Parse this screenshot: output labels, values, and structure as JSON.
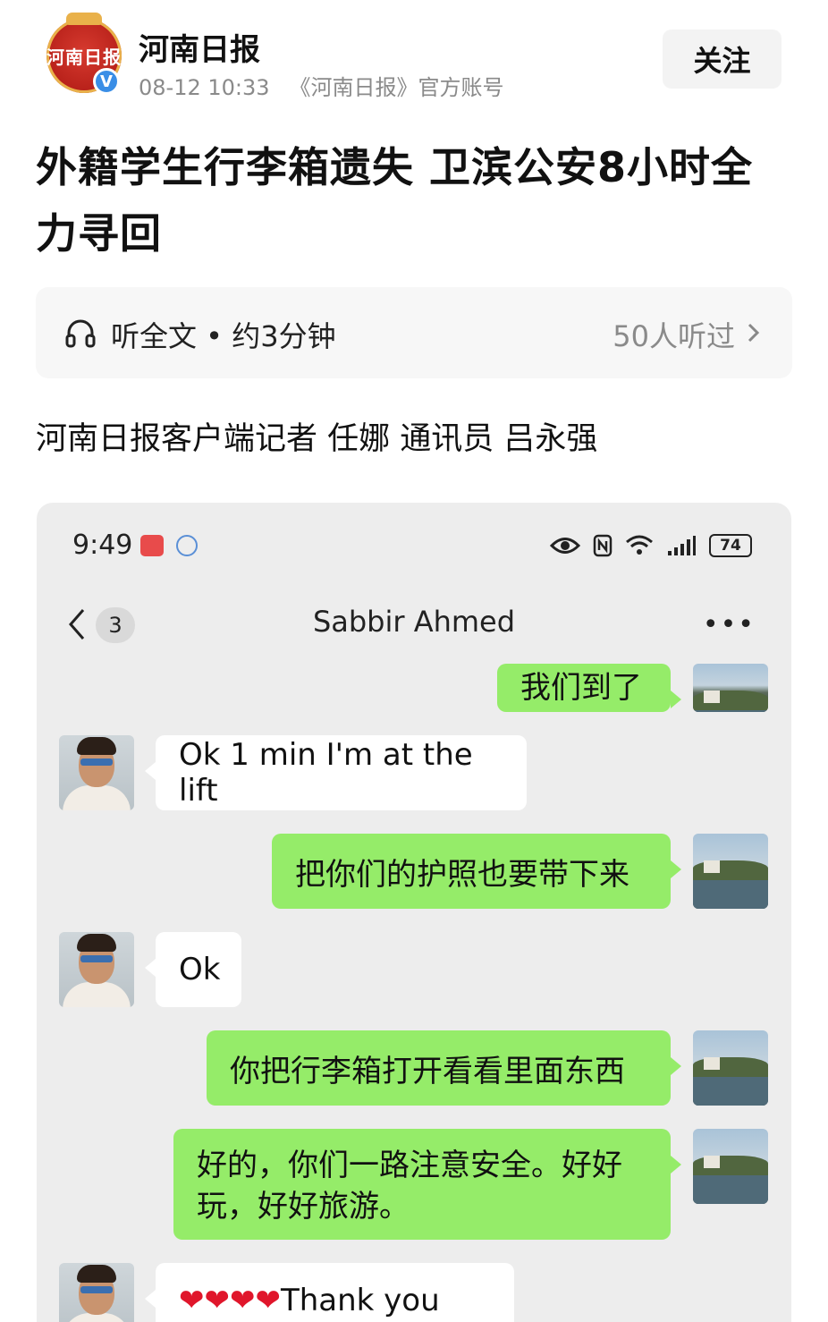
{
  "header": {
    "logo_text": "河南日报",
    "verified_mark": "V",
    "account_name": "河南日报",
    "time": "08-12 10:33",
    "account_desc": "《河南日报》官方账号",
    "follow_label": "关注"
  },
  "article": {
    "title": "外籍学生行李箱遗失 卫滨公安8小时全力寻回",
    "audio_label": "听全文 • 约3分钟",
    "audio_count": "50人听过",
    "byline": "河南日报客户端记者 任娜 通讯员 吕永强"
  },
  "chat_screenshot": {
    "status_time": "9:49",
    "battery": "74",
    "unread_count": "3",
    "contact_name": "Sabbir Ahmed",
    "more_label": "•••",
    "messages": [
      {
        "from": "me",
        "text": "我们到了"
      },
      {
        "from": "them",
        "text": "Ok 1 min I'm at the lift"
      },
      {
        "from": "me",
        "text": "把你们的护照也要带下来"
      },
      {
        "from": "them",
        "text": "Ok"
      },
      {
        "from": "me",
        "text": "你把行李箱打开看看里面东西"
      },
      {
        "from": "me",
        "text": "好的，你们一路注意安全。好好玩，好好旅游。"
      },
      {
        "from": "them",
        "hearts": "❤❤❤❤",
        "text": "Thank you"
      }
    ]
  },
  "icons": {
    "headphones": "headphones-icon",
    "chevron": "chevron-right-icon",
    "back": "back-arrow-icon"
  },
  "colors": {
    "logo_red": "#b8211a",
    "verified_blue": "#3a8ee6",
    "bubble_green": "#95ec69",
    "chat_bg": "#ededed"
  }
}
